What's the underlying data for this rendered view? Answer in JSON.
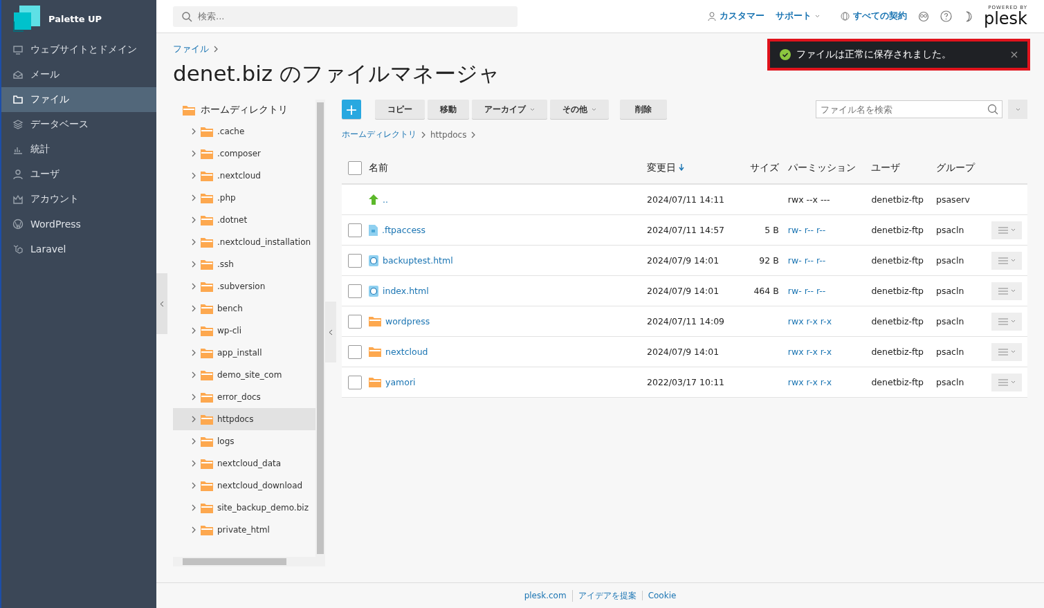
{
  "brand": {
    "name": "Palette UP"
  },
  "nav": [
    {
      "label": "ウェブサイトとドメイン",
      "kind": "monitor",
      "selected": false
    },
    {
      "label": "メール",
      "kind": "mail",
      "selected": false
    },
    {
      "label": "ファイル",
      "kind": "folder",
      "selected": true
    },
    {
      "label": "データベース",
      "kind": "layers",
      "selected": false
    },
    {
      "label": "統計",
      "kind": "chart",
      "selected": false
    },
    {
      "label": "ユーザ",
      "kind": "user",
      "selected": false
    },
    {
      "label": "アカウント",
      "kind": "crown",
      "selected": false
    },
    {
      "label": "WordPress",
      "kind": "wordpress",
      "selected": false
    },
    {
      "label": "Laravel",
      "kind": "laravel",
      "selected": false
    }
  ],
  "search": {
    "placeholder": "検索..."
  },
  "header": {
    "customer": "カスタマー",
    "support": "サポート",
    "subscriptions": "すべての契約",
    "powered_by": "POWERED BY",
    "logo": "plesk"
  },
  "toast": {
    "message": "ファイルは正常に保存されました。"
  },
  "breadcrumb": [
    "ファイル"
  ],
  "title": "denet.biz のファイルマネージャ",
  "tree": {
    "root": "ホームディレクトリ",
    "items": [
      {
        "label": ".cache",
        "selected": false
      },
      {
        "label": ".composer",
        "selected": false
      },
      {
        "label": ".nextcloud",
        "selected": false
      },
      {
        "label": ".php",
        "selected": false
      },
      {
        "label": ".dotnet",
        "selected": false
      },
      {
        "label": ".nextcloud_installation",
        "selected": false
      },
      {
        "label": ".ssh",
        "selected": false
      },
      {
        "label": ".subversion",
        "selected": false
      },
      {
        "label": "bench",
        "selected": false
      },
      {
        "label": "wp-cli",
        "selected": false
      },
      {
        "label": "app_install",
        "selected": false
      },
      {
        "label": "demo_site_com",
        "selected": false
      },
      {
        "label": "error_docs",
        "selected": false
      },
      {
        "label": "httpdocs",
        "selected": true
      },
      {
        "label": "logs",
        "selected": false
      },
      {
        "label": "nextcloud_data",
        "selected": false
      },
      {
        "label": "nextcloud_download",
        "selected": false
      },
      {
        "label": "site_backup_demo.biz",
        "selected": false
      },
      {
        "label": "private_html",
        "selected": false
      }
    ]
  },
  "toolbar": [
    {
      "label": "+",
      "kind": "add"
    },
    {
      "label": "コピー",
      "kind": "plain"
    },
    {
      "label": "移動",
      "kind": "plain"
    },
    {
      "label": "アーカイブ",
      "kind": "dropdown"
    },
    {
      "label": "その他",
      "kind": "dropdown"
    },
    {
      "label": "削除",
      "kind": "plain"
    }
  ],
  "file_search": {
    "placeholder": "ファイル名を検索"
  },
  "path": [
    "ホームディレクトリ",
    "httpdocs"
  ],
  "table": {
    "select_all": {
      "checked": false
    },
    "columns": [
      {
        "label": "名前",
        "sorted": false
      },
      {
        "label": "変更日",
        "sorted": true
      },
      {
        "label": "サイズ",
        "sorted": false
      },
      {
        "label": "パーミッション",
        "sorted": false
      },
      {
        "label": "ユーザ",
        "sorted": false
      },
      {
        "label": "グループ",
        "sorted": false
      }
    ],
    "rows": [
      {
        "kind": "up",
        "name": "..",
        "modified": "2024/07/11 14:11",
        "permission": "rwx --x ---",
        "user": "denetbiz-ftp",
        "group": "psaserv"
      },
      {
        "kind": "file",
        "checked": false,
        "name": ".ftpaccess",
        "modified": "2024/07/11 14:57",
        "size": "5 B",
        "permission": "rw- r-- r--",
        "user": "denetbiz-ftp",
        "group": "psacln"
      },
      {
        "kind": "html",
        "checked": false,
        "name": "backuptest.html",
        "modified": "2024/07/9 14:01",
        "size": "92 B",
        "permission": "rw- r-- r--",
        "user": "denetbiz-ftp",
        "group": "psacln"
      },
      {
        "kind": "html",
        "checked": false,
        "name": "index.html",
        "modified": "2024/07/9 14:01",
        "size": "464 B",
        "permission": "rw- r-- r--",
        "user": "denetbiz-ftp",
        "group": "psacln"
      },
      {
        "kind": "folder",
        "checked": false,
        "name": "wordpress",
        "modified": "2024/07/11 14:09",
        "permission": "rwx r-x r-x",
        "user": "denetbiz-ftp",
        "group": "psacln"
      },
      {
        "kind": "folder",
        "checked": false,
        "name": "nextcloud",
        "modified": "2024/07/9 14:01",
        "permission": "rwx r-x r-x",
        "user": "denetbiz-ftp",
        "group": "psacln"
      },
      {
        "kind": "folder",
        "checked": false,
        "name": "yamori",
        "modified": "2022/03/17 10:11",
        "permission": "rwx r-x r-x",
        "user": "denetbiz-ftp",
        "group": "psacln"
      }
    ]
  },
  "footer": [
    "plesk.com",
    "アイデアを提案",
    "Cookie"
  ]
}
